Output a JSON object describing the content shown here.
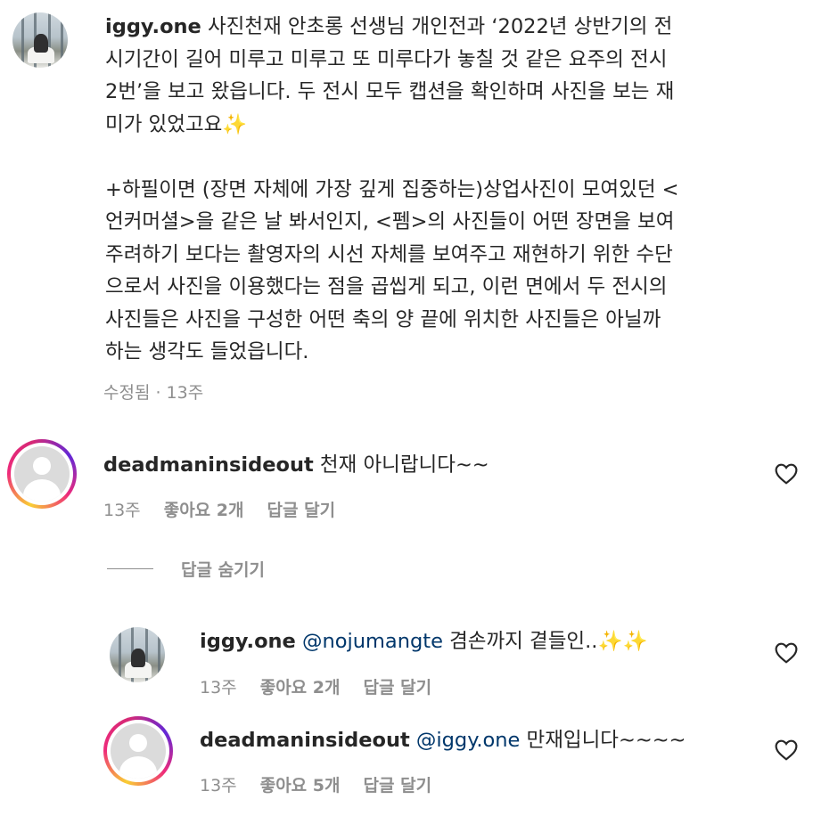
{
  "caption": {
    "username": "iggy.one",
    "lines": [
      "사진천재 안초롱 선생님 개인전과 ‘2022년 상반기의 전",
      "시기간이 길어 미루고 미루고 또 미루다가 놓칠 것 같은 요주의 전시",
      "2번’을 보고 왔읍니다. 두 전시 모두 캡션을 확인하며 사진을 보는 재",
      "미가 있었고요",
      "",
      "+하필이면 (장면 자체에 가장 깊게 집중하는)상업사진이 모여있던 <",
      "언커머셜>을 같은 날 봐서인지, <펨>의 사진들이 어떤 장면을 보여",
      "주려하기 보다는 촬영자의 시선 자체를 보여주고 재현하기 위한 수단",
      "으로서 사진을 이용했다는 점을 곱씹게 되고, 이런 면에서 두 전시의",
      "사진들은 사진을 구성한 어떤 축의 양 끝에 위치한 사진들은 아닐까",
      "하는 생각도 들었읍니다."
    ],
    "first_line_rest": " 사진천재 안초롱 선생님 개인전과 ‘2022년 상반기의 전",
    "sparkle": "✨",
    "meta": "수정됨 · 13주"
  },
  "comments": [
    {
      "username": "deadmaninsideout",
      "text": "천재 아니랍니다~~",
      "time": "13주",
      "likes": "좋아요 2개",
      "reply": "답글 달기"
    }
  ],
  "hide_replies": "답글 숨기기",
  "replies": [
    {
      "username": "iggy.one",
      "mention": "@nojumangte",
      "text": "겸손까지 곁들인..",
      "sparkles": "✨✨",
      "time": "13주",
      "likes": "좋아요 2개",
      "reply": "답글 달기"
    },
    {
      "username": "deadmaninsideout",
      "mention": "@iggy.one",
      "text": "만재입니다~~~~",
      "time": "13주",
      "likes": "좋아요 5개",
      "reply": "답글 달기"
    }
  ],
  "icons": {
    "heart": "heart-outline-icon"
  },
  "colors": {
    "text": "#262626",
    "secondary": "#8e8e8e",
    "mention": "#00376b"
  }
}
